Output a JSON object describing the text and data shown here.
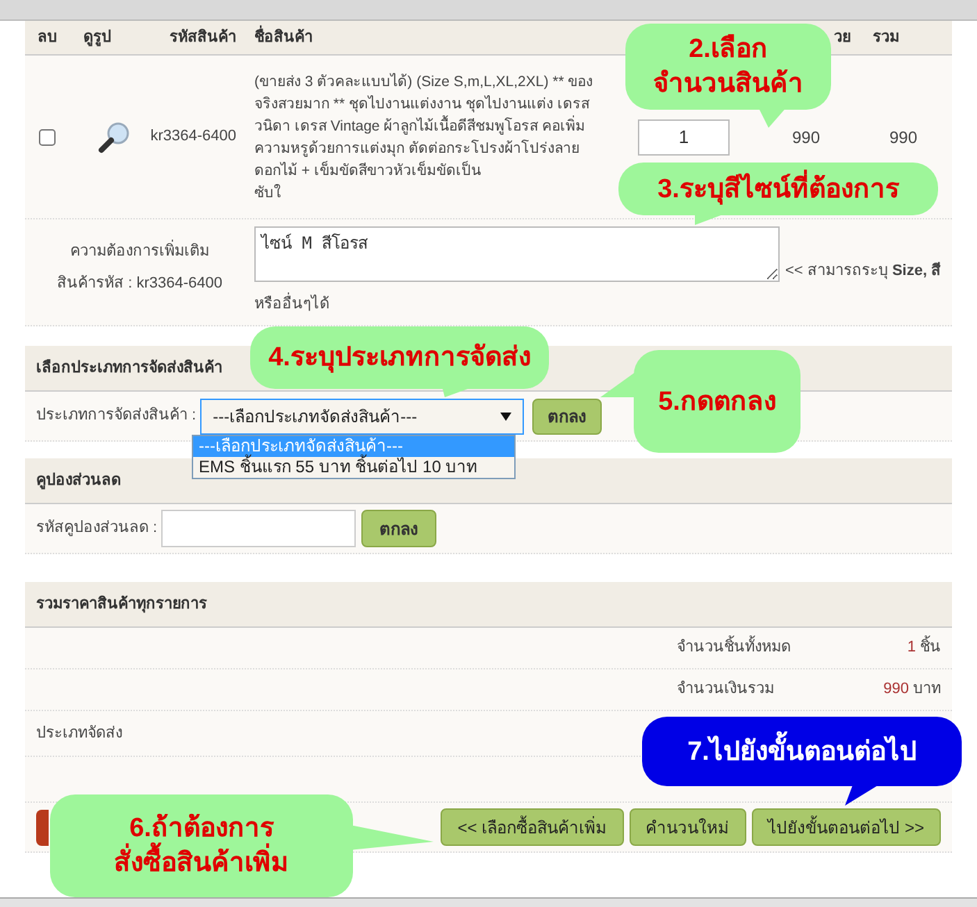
{
  "cart_table": {
    "columns": [
      "ลบ",
      "ดูรูป",
      "รหัสสินค้า",
      "ชื่อสินค้า",
      "วย",
      "รวม"
    ],
    "rows": [
      {
        "checked": false,
        "code": "kr3364-6400",
        "name": "(ขายส่ง 3 ตัวคละแบบได้) (Size S,m,L,XL,2XL) ** ของจริงสวยมาก ** ชุดไปงานแต่งงาน ชุดไปงานแต่ง เดรสวนิดา เดรส Vintage ผ้าลูกไม้เนื้อดีสีชมพูโอรส คอเพิ่มความหรูด้วยการแต่งมุก ตัดต่อกระโปรงผ้าโปร่งลายดอกไม้ + เข็มขัดสีขาวหัวเข็มขัดเป็น",
        "name_end": "ซับใ",
        "quantity": "1",
        "unit_price": "990",
        "total": "990"
      }
    ]
  },
  "note": {
    "label": "ความต้องการเพิ่มเติม",
    "code_label": "สินค้ารหัส : kr3364-6400",
    "value": "ไซน์ M สีโอรส",
    "hint": "<< สามารถระบุ **Size, สี**",
    "hint_more": "หรืออื่นๆได้"
  },
  "shipping": {
    "title": "เลือกประเภทการจัดส่งสินค้า",
    "label": "ประเภทการจัดส่งสินค้า :",
    "value": "---เลือกประเภทจัดส่งสินค้า---",
    "expanded": true,
    "options": [
      {
        "label": "---เลือกประเภทจัดส่งสินค้า---",
        "selected": true
      },
      {
        "label": "EMS ชิ้นแรก 55 บาท ชิ้นต่อไป 10 บาท",
        "selected": false
      }
    ],
    "button": "ตกลง"
  },
  "coupon": {
    "title": "คูปองส่วนลด",
    "label": "รหัสคูปองส่วนลด :",
    "button": "ตกลง"
  },
  "summary": {
    "title": "รวมราคาสินค้าทุกรายการ",
    "rows": [
      {
        "label": "จำนวนชิ้นทั้งหมด",
        "value": "1",
        "unit": "ชิ้น"
      },
      {
        "label": "จำนวนเงินรวม",
        "value": "990",
        "unit": "บาท"
      }
    ],
    "shipping_label": "ประเภทจัดส่ง"
  },
  "buttons": [
    "<< เลือกซื้อสินค้าเพิ่ม",
    "คำนวนใหม่",
    "ไปยังขั้นตอนต่อไป >>"
  ],
  "callouts": [
    {
      "kind": "green",
      "lines": [
        "2.เลือก",
        "จำนวนสินค้า"
      ]
    },
    {
      "kind": "green",
      "lines": [
        "3.ระบุสีไซน์ที่ต้องการ"
      ]
    },
    {
      "kind": "green",
      "lines": [
        "4.ระบุประเภทการจัดส่ง"
      ]
    },
    {
      "kind": "green",
      "lines": [
        "5.กดตกลง"
      ]
    },
    {
      "kind": "blue",
      "lines": [
        "7.ไปยังขั้นตอนต่อไป"
      ]
    },
    {
      "kind": "green",
      "lines": [
        "6.ถ้าต้องการ",
        "สั่งซื้อสินค้าเพิ่ม"
      ]
    }
  ]
}
